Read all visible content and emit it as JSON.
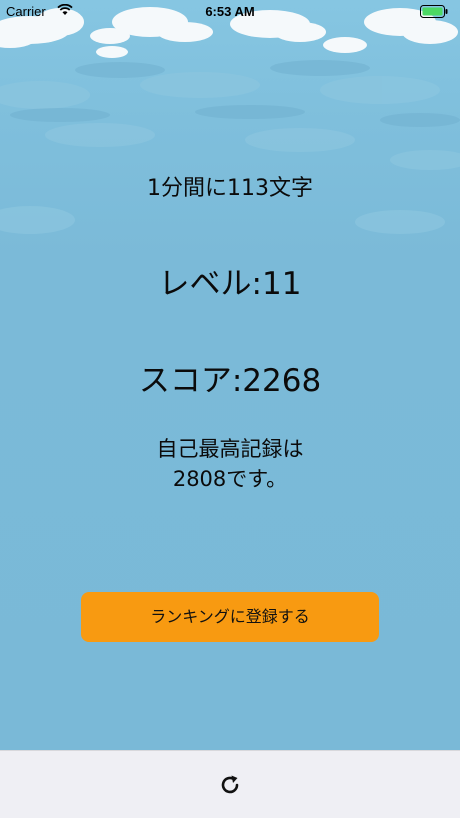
{
  "status_bar": {
    "carrier": "Carrier",
    "time": "6:53 AM",
    "icons": [
      "wifi-icon",
      "battery-icon"
    ],
    "battery_color": "#4cd964"
  },
  "result": {
    "rate_text": "1分間に113文字",
    "level_text": "レベル:11",
    "score_text": "スコア:2268",
    "best_line1": "自己最高記録は",
    "best_line2": "2808です。"
  },
  "button": {
    "ranking_label": "ランキングに登録する",
    "color": "#f89a11"
  },
  "tab_bar": {
    "icon": "reload-icon",
    "background": "#efeff4"
  },
  "colors": {
    "sky": "#7ab9d7",
    "cloud": "#ffffff"
  }
}
